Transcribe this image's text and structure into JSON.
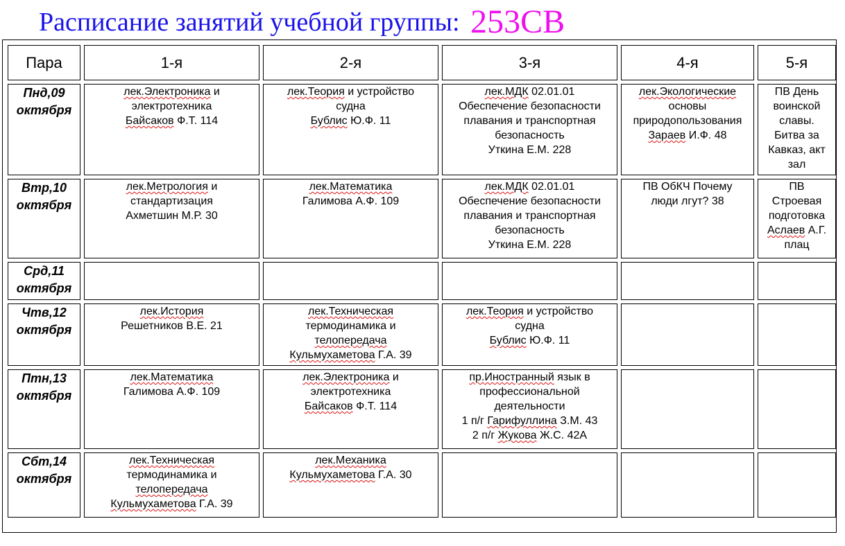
{
  "title": {
    "text": "Расписание занятий учебной группы:",
    "group": "253СВ"
  },
  "header": [
    "Пара",
    "1-я",
    "2-я",
    "3-я",
    "4-я",
    "5-я"
  ],
  "rows": [
    {
      "day": [
        "Пнд,09",
        "октября"
      ],
      "cells": [
        [
          [
            [
              "лек.Электроника",
              true
            ],
            [
              " и",
              false
            ]
          ],
          [
            [
              "электротехника",
              false
            ]
          ],
          [
            [
              "Байсаков",
              true
            ],
            [
              " Ф.Т. 114",
              false
            ]
          ]
        ],
        [
          [
            [
              "лек.Теория",
              true
            ],
            [
              " и устройство",
              false
            ]
          ],
          [
            [
              "судна",
              false
            ]
          ],
          [
            [
              "Бублис",
              true
            ],
            [
              " Ю.Ф. 11",
              false
            ]
          ]
        ],
        [
          [
            [
              "лек.МДК",
              true
            ],
            [
              " 02.01.01",
              false
            ]
          ],
          [
            [
              "Обеспечение безопасности",
              false
            ]
          ],
          [
            [
              "плавания и транспортная",
              false
            ]
          ],
          [
            [
              "безопасность",
              false
            ]
          ],
          [
            [
              "Уткина Е.М. 228",
              false
            ]
          ]
        ],
        [
          [
            [
              "лек.Экологические",
              true
            ]
          ],
          [
            [
              "основы",
              false
            ]
          ],
          [
            [
              "природопользования",
              false
            ]
          ],
          [
            [
              "Зараев",
              true
            ],
            [
              " И.Ф. 48",
              false
            ]
          ]
        ],
        [
          [
            [
              "ПВ День",
              false
            ]
          ],
          [
            [
              "воинской",
              false
            ]
          ],
          [
            [
              "славы.",
              false
            ]
          ],
          [
            [
              "Битва за",
              false
            ]
          ],
          [
            [
              "Кавказ, акт",
              false
            ]
          ],
          [
            [
              "зал",
              false
            ]
          ]
        ]
      ]
    },
    {
      "day": [
        "Втр,10",
        "октября"
      ],
      "cells": [
        [
          [
            [
              "лек.Метрология",
              true
            ],
            [
              " и",
              false
            ]
          ],
          [
            [
              "стандартизация",
              false
            ]
          ],
          [
            [
              "Ахметшин М.Р. 30",
              false
            ]
          ]
        ],
        [
          [
            [
              "лек.Математика",
              true
            ]
          ],
          [
            [
              "Галимова А.Ф. 109",
              false
            ]
          ]
        ],
        [
          [
            [
              "лек.МДК",
              true
            ],
            [
              " 02.01.01",
              false
            ]
          ],
          [
            [
              "Обеспечение безопасности",
              false
            ]
          ],
          [
            [
              "плавания и транспортная",
              false
            ]
          ],
          [
            [
              "безопасность",
              false
            ]
          ],
          [
            [
              "Уткина Е.М. 228",
              false
            ]
          ]
        ],
        [
          [
            [
              "ПВ ОбКЧ Почему",
              false
            ]
          ],
          [
            [
              "люди лгут? 38",
              false
            ]
          ]
        ],
        [
          [
            [
              "ПВ",
              false
            ]
          ],
          [
            [
              "Строевая",
              false
            ]
          ],
          [
            [
              "подготовка",
              false
            ]
          ],
          [
            [
              "Аслаев",
              true
            ],
            [
              " А.Г.",
              false
            ]
          ],
          [
            [
              "плац",
              false
            ]
          ]
        ]
      ]
    },
    {
      "day": [
        "Срд,11",
        "октября"
      ],
      "cells": [
        [],
        [],
        [],
        [],
        []
      ]
    },
    {
      "day": [
        "Чтв,12",
        "октября"
      ],
      "cells": [
        [
          [
            [
              "лек.История",
              true
            ]
          ],
          [
            [
              "Решетников В.Е. 21",
              false
            ]
          ]
        ],
        [
          [
            [
              "лек.Техническая",
              true
            ]
          ],
          [
            [
              "термодинамика и",
              false
            ]
          ],
          [
            [
              "телопередача",
              true
            ]
          ],
          [
            [
              "Кульмухаметова",
              true
            ],
            [
              " Г.А. 39",
              false
            ]
          ]
        ],
        [
          [
            [
              "лек.Теория",
              true
            ],
            [
              " и устройство",
              false
            ]
          ],
          [
            [
              "судна",
              false
            ]
          ],
          [
            [
              "Бублис",
              true
            ],
            [
              " Ю.Ф. 11",
              false
            ]
          ]
        ],
        [],
        []
      ]
    },
    {
      "day": [
        "Птн,13",
        "октября"
      ],
      "cells": [
        [
          [
            [
              "лек.Математика",
              true
            ]
          ],
          [
            [
              "Галимова А.Ф. 109",
              false
            ]
          ]
        ],
        [
          [
            [
              "лек.Электроника",
              true
            ],
            [
              " и",
              false
            ]
          ],
          [
            [
              "электротехника",
              false
            ]
          ],
          [
            [
              "Байсаков",
              true
            ],
            [
              " Ф.Т. 114",
              false
            ]
          ]
        ],
        [
          [
            [
              "пр.Иностранный",
              true
            ],
            [
              " язык в",
              false
            ]
          ],
          [
            [
              "профессиональной",
              false
            ]
          ],
          [
            [
              "деятельности",
              false
            ]
          ],
          [
            [
              "1 п/г ",
              false
            ],
            [
              "Гарифуллина",
              true
            ],
            [
              " З.М. 43",
              false
            ]
          ],
          [
            [
              "2 п/г ",
              false
            ],
            [
              "Жукова",
              true
            ],
            [
              " Ж.С. 42А",
              false
            ]
          ]
        ],
        [],
        []
      ]
    },
    {
      "day": [
        "Сбт,14",
        "октября"
      ],
      "cells": [
        [
          [
            [
              "лек.Техническая",
              true
            ]
          ],
          [
            [
              "термодинамика и",
              false
            ]
          ],
          [
            [
              "телопередача",
              true
            ]
          ],
          [
            [
              "Кульмухаметова",
              true
            ],
            [
              " Г.А. 39",
              false
            ]
          ]
        ],
        [
          [
            [
              "лек.Механика",
              true
            ]
          ],
          [
            [
              "Кульмухаметова",
              true
            ],
            [
              " Г.А. 30",
              false
            ]
          ]
        ],
        [],
        [],
        []
      ]
    }
  ],
  "colors": {
    "title": "#1a13e8",
    "group": "#ee10ee",
    "spellcheck": "#d11111"
  }
}
